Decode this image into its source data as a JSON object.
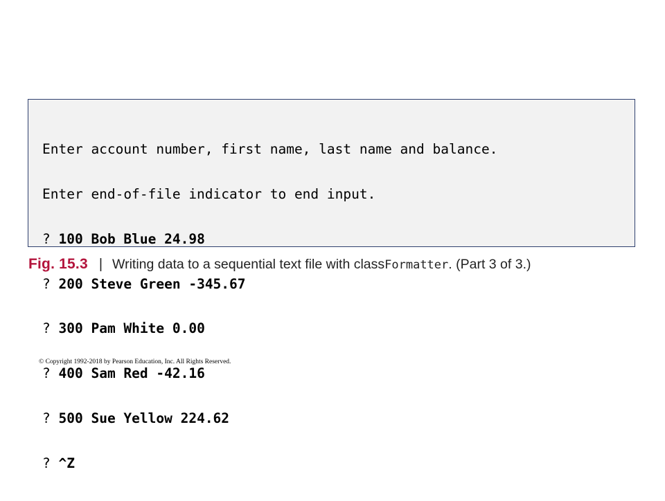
{
  "console": {
    "header_lines": [
      "Enter account number, first name, last name and balance.",
      "Enter end-of-file indicator to end input."
    ],
    "prompt_symbol": "?",
    "input_lines": [
      "100 Bob Blue 24.98",
      "200 Steve Green -345.67",
      "300 Pam White 0.00",
      "400 Sam Red -42.16",
      "500 Sue Yellow 224.62",
      "^Z"
    ]
  },
  "caption": {
    "figure_label": "Fig. 15.3",
    "separator": "|",
    "text_before_code": "Writing data to a sequential text file with class ",
    "code": "Formatter",
    "text_after_code": ". (Part 3 of 3.)"
  },
  "footer": {
    "copyright": "© Copyright 1992-2018 by Pearson Education, Inc. All Rights Reserved."
  },
  "colors": {
    "figure_label": "#b3143c",
    "box_border": "#2e3f6e",
    "box_background": "#f2f2f2"
  }
}
